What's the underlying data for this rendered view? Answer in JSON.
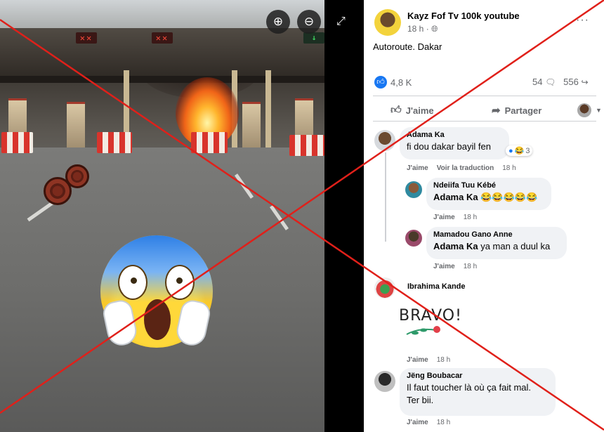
{
  "video": {
    "zoom_in_icon": "zoom-in-icon",
    "zoom_out_icon": "zoom-out-icon",
    "fullscreen_icon": "expand-icon",
    "toll_signs": [
      "✕✕",
      "✕✕"
    ]
  },
  "post": {
    "author": "Kayz Fof Tv 100k youtube",
    "time": "18 h ·",
    "text": "Autoroute. Dakar",
    "reaction_count": "4,8 K",
    "comments_count": "54",
    "shares_count": "556",
    "like_label": "J'aime",
    "share_label": "Partager"
  },
  "comments": [
    {
      "name": "Adama Ka",
      "text": "fi dou dakar bayil fen",
      "reaction_count": "3",
      "like_label": "J'aime",
      "translate_label": "Voir la traduction",
      "time": "18 h"
    },
    {
      "name": "Ndeiifa Tuu Kébé",
      "mention": "Adama Ka",
      "text": "😂😂😂😂😂",
      "like_label": "J'aime",
      "time": "18 h"
    },
    {
      "name": "Mamadou Gano Anne",
      "mention": "Adama Ka",
      "text": "ya man a duul ka",
      "like_label": "J'aime",
      "time": "18 h"
    },
    {
      "name": "Ibrahima Kande",
      "text": "BRAVO!",
      "like_label": "J'aime",
      "time": "18 h"
    },
    {
      "name": "Jëng Boubacar",
      "text_line1": "Il faut toucher là où ça fait mal.",
      "text_line2": "Ter bii.",
      "like_label": "J'aime",
      "time": "18 h"
    }
  ],
  "colors": {
    "cross": "#e0201a",
    "facebook_blue": "#1877f2",
    "bubble": "#f0f2f5"
  }
}
